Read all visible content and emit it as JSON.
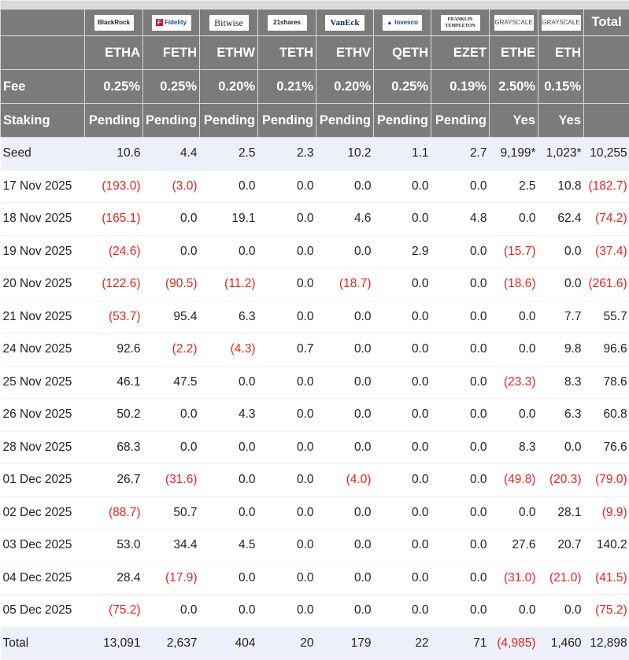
{
  "columns": [
    {
      "issuer": "BlackRock",
      "ticker": "ETHA",
      "fee": "0.25%",
      "staking": "Pending"
    },
    {
      "issuer": "Fidelity",
      "ticker": "FETH",
      "fee": "0.25%",
      "staking": "Pending"
    },
    {
      "issuer": "Bitwise",
      "ticker": "ETHW",
      "fee": "0.20%",
      "staking": "Pending"
    },
    {
      "issuer": "21shares",
      "ticker": "TETH",
      "fee": "0.21%",
      "staking": "Pending"
    },
    {
      "issuer": "VanEck",
      "ticker": "ETHV",
      "fee": "0.20%",
      "staking": "Pending"
    },
    {
      "issuer": "Invesco",
      "ticker": "QETH",
      "fee": "0.25%",
      "staking": "Pending"
    },
    {
      "issuer": "Franklin Templeton",
      "ticker": "EZET",
      "fee": "0.19%",
      "staking": "Pending"
    },
    {
      "issuer": "Grayscale",
      "ticker": "ETHE",
      "fee": "2.50%",
      "staking": "Yes"
    },
    {
      "issuer": "Grayscale",
      "ticker": "ETH",
      "fee": "0.15%",
      "staking": "Yes"
    }
  ],
  "header": {
    "total_label": "Total",
    "fee_label": "Fee",
    "staking_label": "Staking"
  },
  "colors": {
    "header_bg": "#7b7b7b",
    "highlight_row": "#edf0fb",
    "negative": "#e8231f"
  },
  "rows": [
    {
      "label": "Seed",
      "values": [
        "10.6",
        "4.4",
        "2.5",
        "2.3",
        "10.2",
        "1.1",
        "2.7",
        "9,199*",
        "1,023*",
        "10,255"
      ]
    },
    {
      "label": "17 Nov 2025",
      "values": [
        "(193.0)",
        "(3.0)",
        "0.0",
        "0.0",
        "0.0",
        "0.0",
        "0.0",
        "2.5",
        "10.8",
        "(182.7)"
      ]
    },
    {
      "label": "18 Nov 2025",
      "values": [
        "(165.1)",
        "0.0",
        "19.1",
        "0.0",
        "4.6",
        "0.0",
        "4.8",
        "0.0",
        "62.4",
        "(74.2)"
      ]
    },
    {
      "label": "19 Nov 2025",
      "values": [
        "(24.6)",
        "0.0",
        "0.0",
        "0.0",
        "0.0",
        "2.9",
        "0.0",
        "(15.7)",
        "0.0",
        "(37.4)"
      ]
    },
    {
      "label": "20 Nov 2025",
      "values": [
        "(122.6)",
        "(90.5)",
        "(11.2)",
        "0.0",
        "(18.7)",
        "0.0",
        "0.0",
        "(18.6)",
        "0.0",
        "(261.6)"
      ]
    },
    {
      "label": "21 Nov 2025",
      "values": [
        "(53.7)",
        "95.4",
        "6.3",
        "0.0",
        "0.0",
        "0.0",
        "0.0",
        "0.0",
        "7.7",
        "55.7"
      ]
    },
    {
      "label": "24 Nov 2025",
      "values": [
        "92.6",
        "(2.2)",
        "(4.3)",
        "0.7",
        "0.0",
        "0.0",
        "0.0",
        "0.0",
        "9.8",
        "96.6"
      ]
    },
    {
      "label": "25 Nov 2025",
      "values": [
        "46.1",
        "47.5",
        "0.0",
        "0.0",
        "0.0",
        "0.0",
        "0.0",
        "(23.3)",
        "8.3",
        "78.6"
      ]
    },
    {
      "label": "26 Nov 2025",
      "values": [
        "50.2",
        "0.0",
        "4.3",
        "0.0",
        "0.0",
        "0.0",
        "0.0",
        "0.0",
        "6.3",
        "60.8"
      ]
    },
    {
      "label": "28 Nov 2025",
      "values": [
        "68.3",
        "0.0",
        "0.0",
        "0.0",
        "0.0",
        "0.0",
        "0.0",
        "8.3",
        "0.0",
        "76.6"
      ]
    },
    {
      "label": "01 Dec 2025",
      "values": [
        "26.7",
        "(31.6)",
        "0.0",
        "0.0",
        "(4.0)",
        "0.0",
        "0.0",
        "(49.8)",
        "(20.3)",
        "(79.0)"
      ]
    },
    {
      "label": "02 Dec 2025",
      "values": [
        "(88.7)",
        "50.7",
        "0.0",
        "0.0",
        "0.0",
        "0.0",
        "0.0",
        "0.0",
        "28.1",
        "(9.9)"
      ]
    },
    {
      "label": "03 Dec 2025",
      "values": [
        "53.0",
        "34.4",
        "4.5",
        "0.0",
        "0.0",
        "0.0",
        "0.0",
        "27.6",
        "20.7",
        "140.2"
      ]
    },
    {
      "label": "04 Dec 2025",
      "values": [
        "28.4",
        "(17.9)",
        "0.0",
        "0.0",
        "0.0",
        "0.0",
        "0.0",
        "(31.0)",
        "(21.0)",
        "(41.5)"
      ]
    },
    {
      "label": "05 Dec 2025",
      "values": [
        "(75.2)",
        "0.0",
        "0.0",
        "0.0",
        "0.0",
        "0.0",
        "0.0",
        "0.0",
        "0.0",
        "(75.2)"
      ]
    },
    {
      "label": "Total",
      "values": [
        "13,091",
        "2,637",
        "404",
        "20",
        "179",
        "22",
        "71",
        "(4,985)",
        "1,460",
        "12,898"
      ]
    }
  ]
}
